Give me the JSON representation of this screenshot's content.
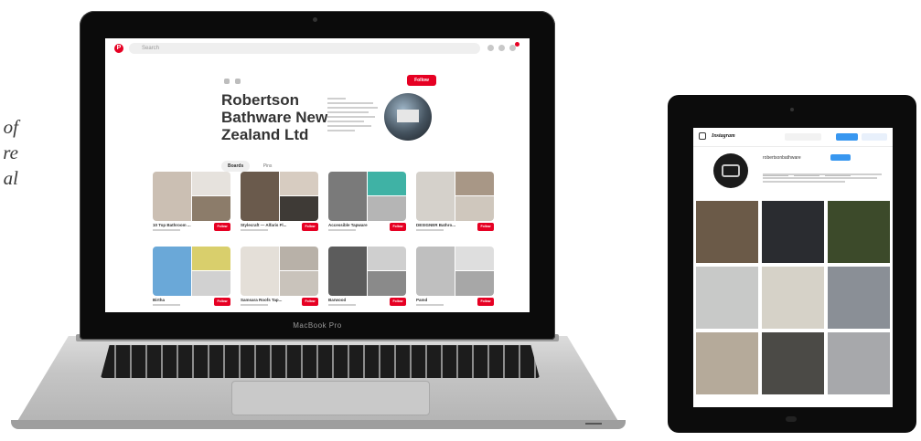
{
  "side_caption": [
    "of",
    "re",
    "al"
  ],
  "laptop": {
    "brand_label": "MacBook Pro",
    "pinterest": {
      "logo": "P",
      "search_placeholder": "Search",
      "follow_label": "Follow",
      "title_lines": [
        "Robertson",
        "Bathware New",
        "Zealand Ltd"
      ],
      "tabs": [
        {
          "label": "Boards",
          "active": true
        },
        {
          "label": "Pins",
          "active": false
        }
      ],
      "boards": [
        {
          "name": "10 Top Bathroom ...",
          "colors": [
            "#cbbfb3",
            "#e6e2dd",
            "#8c7c6a"
          ]
        },
        {
          "name": "Stylecraft — Alfaris Fl...",
          "colors": [
            "#6a5a4c",
            "#d7ccc1",
            "#3e3a36"
          ]
        },
        {
          "name": "Accessible Tapware",
          "colors": [
            "#7a7a7a",
            "#3fb2a5",
            "#b5b5b5"
          ]
        },
        {
          "name": "DESIGNER Bathro...",
          "colors": [
            "#d5d1cb",
            "#a89786",
            "#cfc7bd"
          ]
        },
        {
          "name": "Birtha",
          "colors": [
            "#6aa8d8",
            "#d9cf6c",
            "#d1d1d1"
          ]
        },
        {
          "name": "Samsara Roofs Tap...",
          "colors": [
            "#e4dfd8",
            "#b8b1a8",
            "#c9c3bb"
          ]
        },
        {
          "name": "Barwood",
          "colors": [
            "#5c5c5c",
            "#cfcfcf",
            "#8a8a8a"
          ]
        },
        {
          "name": "Pamd",
          "colors": [
            "#bfbfbf",
            "#dedede",
            "#a7a7a7"
          ]
        }
      ]
    }
  },
  "tablet": {
    "instagram": {
      "logo": "Instagram",
      "handle": "robertsonbathware",
      "cells": [
        "#6b5a48",
        "#2a2c30",
        "#3c4a2a",
        "#c8c9c8",
        "#d6d2c8",
        "#8a8f96",
        "#b5aa9a",
        "#4b4a46",
        "#a7a8ab"
      ]
    }
  }
}
